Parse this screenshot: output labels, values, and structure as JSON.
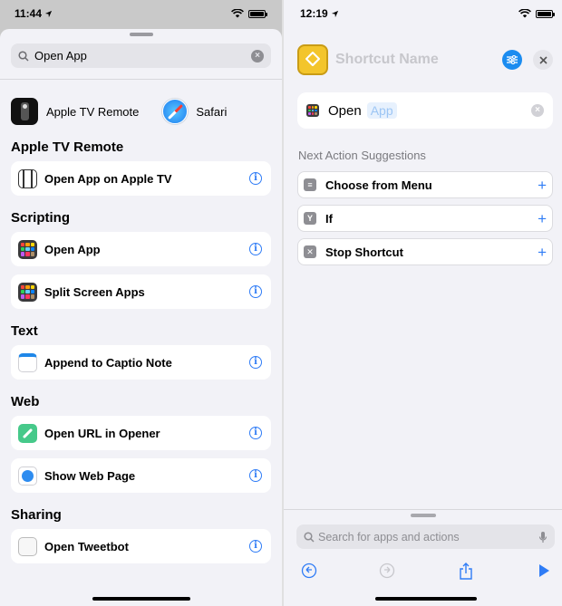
{
  "left": {
    "status": {
      "time": "11:44"
    },
    "search": {
      "value": "Open App"
    },
    "apps": [
      {
        "label": "Apple TV Remote"
      },
      {
        "label": "Safari"
      }
    ],
    "sections": [
      {
        "title": "Apple TV Remote",
        "items": [
          {
            "label": "Open App on Apple TV"
          }
        ]
      },
      {
        "title": "Scripting",
        "items": [
          {
            "label": "Open App"
          },
          {
            "label": "Split Screen Apps"
          }
        ]
      },
      {
        "title": "Text",
        "items": [
          {
            "label": "Append to Captio Note"
          }
        ]
      },
      {
        "title": "Web",
        "items": [
          {
            "label": "Open URL in Opener"
          },
          {
            "label": "Show Web Page"
          }
        ]
      },
      {
        "title": "Sharing",
        "items": [
          {
            "label": "Open Tweetbot"
          }
        ]
      }
    ]
  },
  "right": {
    "status": {
      "time": "12:19"
    },
    "shortcut_name": "Shortcut Name",
    "action": {
      "verb": "Open",
      "param": "App"
    },
    "next_title": "Next Action Suggestions",
    "suggestions": [
      {
        "label": "Choose from Menu"
      },
      {
        "label": "If"
      },
      {
        "label": "Stop Shortcut"
      }
    ],
    "search_placeholder": "Search for apps and actions"
  },
  "colors": {
    "accent": "#2f7cf6",
    "shortcut_icon": "#f3c52b",
    "sheet_background": "#f2f2f7"
  }
}
